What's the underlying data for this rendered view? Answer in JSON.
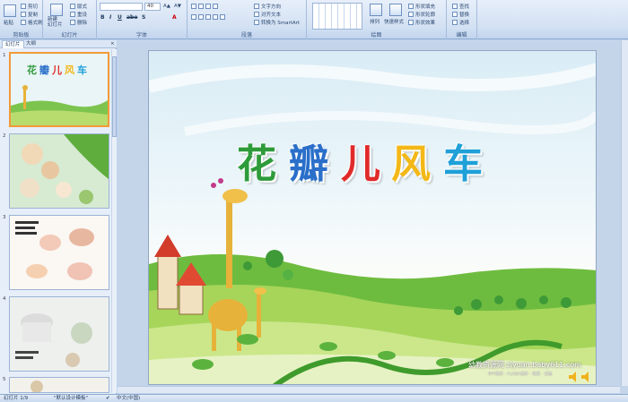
{
  "ribbon": {
    "clipboard": {
      "paste": "粘贴",
      "cut": "剪切",
      "copy": "复制",
      "format_painter": "格式刷",
      "label": "剪贴板"
    },
    "slides": {
      "new_slide": "新建\n幻灯片",
      "layout": "版式",
      "reset": "重设",
      "delete": "删除",
      "label": "幻灯片"
    },
    "font": {
      "size": "40",
      "label": "字体"
    },
    "paragraph": {
      "text_direction": "文字方向",
      "align_text": "对齐文本",
      "smartart": "转换为 SmartArt",
      "label": "段落"
    },
    "drawing": {
      "arrange": "排列",
      "quick_styles": "快速样式",
      "shape_fill": "形状填充",
      "shape_outline": "形状轮廓",
      "shape_effects": "形状效果",
      "label": "绘图"
    },
    "editing": {
      "find": "查找",
      "replace": "替换",
      "select": "选择",
      "label": "编辑"
    }
  },
  "panel": {
    "tab_slides": "幻灯片",
    "tab_outline": "大纲",
    "thumbnails": [
      {
        "num": "1"
      },
      {
        "num": "2"
      },
      {
        "num": "3"
      },
      {
        "num": "4"
      },
      {
        "num": "5"
      }
    ]
  },
  "slide": {
    "title_chars": [
      "花",
      "瓣",
      "儿",
      "风",
      "车"
    ],
    "title_colors": [
      "#2e9b3a",
      "#2a6fc9",
      "#e02a2a",
      "#f3b817",
      "#1fa0d8"
    ],
    "watermark_main": "幼教资源网 ziyuan.baby611.com",
    "watermark_sub": "PPT课件 · FLASH课件 · 教案 · 试卷"
  },
  "status": {
    "slide_info": "幻灯片 1/9",
    "theme": "\"默认设计模板\"",
    "language": "中文(中国)"
  }
}
